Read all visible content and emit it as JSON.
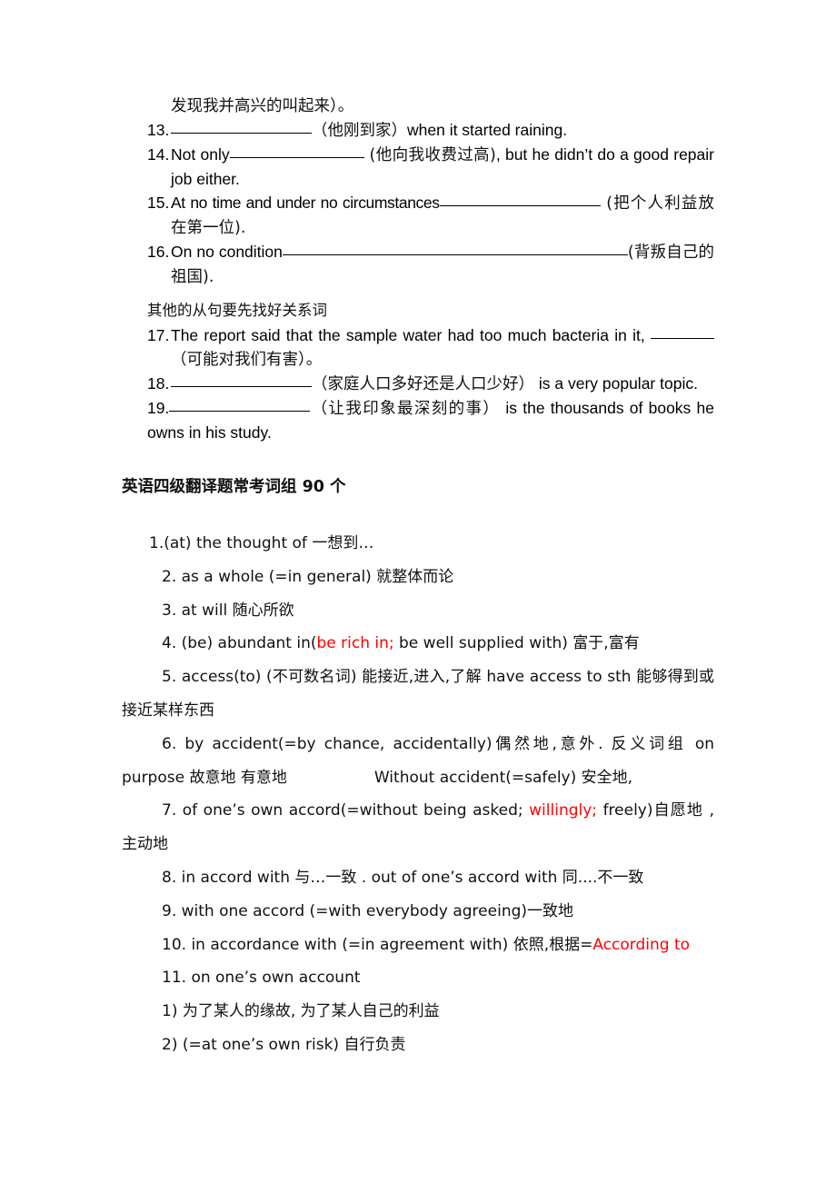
{
  "document": {
    "section_exercises": {
      "carryover_line": "发现我并高兴的叫起来）。",
      "items": [
        {
          "num": "13.",
          "parts": [
            {
              "t": "blank",
              "size": "b-l"
            },
            {
              "t": "cn",
              "v": "（他刚到家）"
            },
            {
              "t": "en",
              "v": "when it started raining."
            }
          ]
        },
        {
          "num": "14.",
          "parts": [
            {
              "t": "en",
              "v": "Not only"
            },
            {
              "t": "blank",
              "size": "b-m"
            },
            {
              "t": "cn",
              "v": " (他向我收费过高)"
            },
            {
              "t": "en",
              "v": ", but he didn’t do a good repair job either."
            }
          ]
        },
        {
          "num": "15.",
          "parts": [
            {
              "t": "en",
              "v": "At no time and under no circumstances"
            },
            {
              "t": "blank",
              "size": "b-xl"
            },
            {
              "t": "cn",
              "v": "  (把个人利益放在第一位)."
            }
          ]
        },
        {
          "num": "16.",
          "parts": [
            {
              "t": "en",
              "v": "On no condition"
            },
            {
              "t": "blank",
              "size": "b-xxl"
            },
            {
              "t": "cn",
              "v": "(背叛自己的祖国)."
            }
          ]
        }
      ]
    },
    "note": "其他的从句要先找好关系词",
    "section_exercises2": {
      "items": [
        {
          "num": "17.",
          "parts": [
            {
              "t": "en",
              "v": "The report said that the sample water had too much bacteria in it, "
            },
            {
              "t": "blank",
              "size": "b-s"
            },
            {
              "t": "cn",
              "v": "（可能对我们有害）。"
            }
          ]
        },
        {
          "num": "18.",
          "parts": [
            {
              "t": "blank",
              "size": "b-l"
            },
            {
              "t": "cn",
              "v": "（家庭人口多好还是人口少好）"
            },
            {
              "t": "en",
              "v": " is a very popular topic."
            }
          ]
        },
        {
          "num": "19.",
          "parts": [
            {
              "t": "blank",
              "size": "b-l"
            },
            {
              "t": "cn",
              "v": "（让我印象最深刻的事）"
            },
            {
              "t": "en",
              "v": "  is the thousands of books he owns in his study."
            }
          ]
        }
      ]
    },
    "phrase_section": {
      "heading": "英语四级翻译题常考词组 90 个",
      "items": [
        {
          "id": "1",
          "segments": [
            {
              "color": "black",
              "text": "1.(at) the thought of 一想到…"
            }
          ]
        },
        {
          "id": "2",
          "segments": [
            {
              "color": "black",
              "text": "2. as a whole (=in general) 就整体而论"
            }
          ]
        },
        {
          "id": "3",
          "segments": [
            {
              "color": "black",
              "text": "3. at will 随心所欲"
            }
          ]
        },
        {
          "id": "4",
          "segments": [
            {
              "color": "black",
              "text": "4. (be) abundant in("
            },
            {
              "color": "red",
              "text": "be rich in;"
            },
            {
              "color": "black",
              "text": " be well supplied with) 富于,富有"
            }
          ]
        },
        {
          "id": "5",
          "segments": [
            {
              "color": "black",
              "text": "5. access(to) (不可数名词) 能接近,进入,了解 have access to sth 能够得到或接近某样东西"
            }
          ]
        },
        {
          "id": "6",
          "segments": [
            {
              "color": "black",
              "text": "6. by accident(=by chance, accidentally)偶然地,意外. 反义词组 on purpose  故意地 有意地"
            },
            {
              "color": "gap",
              "text": ""
            },
            {
              "color": "black",
              "text": "Without accident(=safely) 安全地,"
            }
          ]
        },
        {
          "id": "7",
          "segments": [
            {
              "color": "black",
              "text": "7. of one’s own accord(=without being asked; "
            },
            {
              "color": "red",
              "text": "willingly;"
            },
            {
              "color": "black",
              "text": " freely)自愿地 ,主动地"
            }
          ]
        },
        {
          "id": "8",
          "segments": [
            {
              "color": "black",
              "text": "8. in accord with 与…一致 . out of one’s accord with 同....不一致"
            }
          ]
        },
        {
          "id": "9",
          "segments": [
            {
              "color": "black",
              "text": "9. with one accord (=with everybody agreeing)一致地"
            }
          ]
        },
        {
          "id": "10",
          "segments": [
            {
              "color": "black",
              "text": "10. in accordance with (=in agreement with) 依照,根据="
            },
            {
              "color": "red",
              "text": "According to"
            }
          ]
        },
        {
          "id": "11",
          "segments": [
            {
              "color": "black",
              "text": "11. on one’s own account"
            }
          ]
        },
        {
          "id": "11-1",
          "segments": [
            {
              "color": "black",
              "text": "1) 为了某人的缘故, 为了某人自己的利益"
            }
          ]
        },
        {
          "id": "11-2",
          "segments": [
            {
              "color": "black",
              "text": "2) (=at one’s own risk) 自行负责"
            }
          ]
        }
      ]
    }
  }
}
